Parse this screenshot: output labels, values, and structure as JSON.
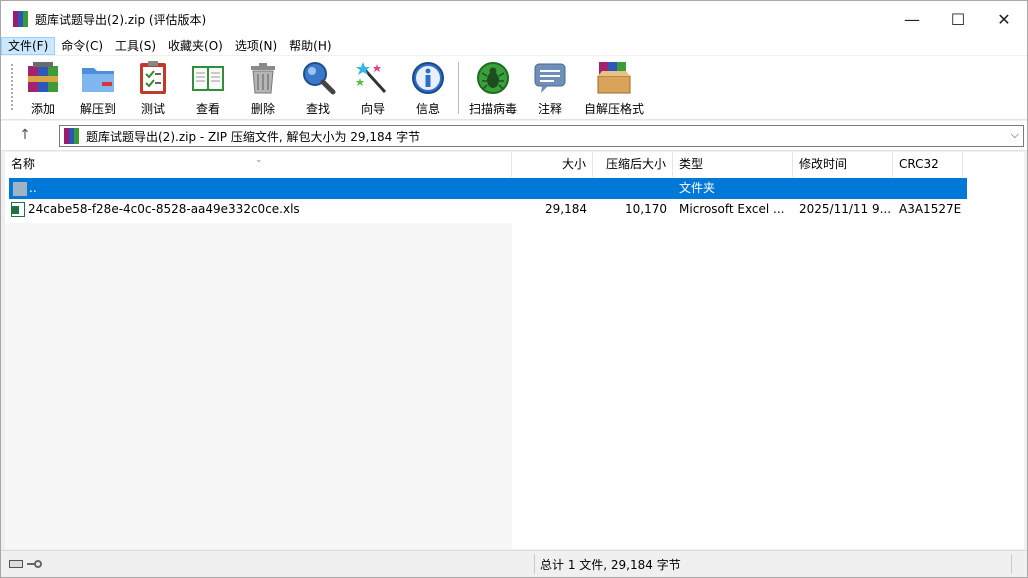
{
  "window": {
    "title": "题库试题导出(2).zip (评估版本)",
    "controls": {
      "minimize": "—",
      "maximize": "☐",
      "close": "✕"
    }
  },
  "menu": [
    {
      "label": "文件(F)",
      "active": true
    },
    {
      "label": "命令(C)"
    },
    {
      "label": "工具(S)"
    },
    {
      "label": "收藏夹(O)"
    },
    {
      "label": "选项(N)"
    },
    {
      "label": "帮助(H)"
    }
  ],
  "toolbar": {
    "add": "添加",
    "extract": "解压到",
    "test": "测试",
    "view": "查看",
    "delete": "删除",
    "find": "查找",
    "wizard": "向导",
    "info": "信息",
    "virus_scan": "扫描病毒",
    "comment": "注释",
    "sfx": "自解压格式"
  },
  "address": {
    "up": "↑",
    "text": "题库试题导出(2).zip - ZIP 压缩文件, 解包大小为 29,184 字节",
    "dropdown": "⌵"
  },
  "columns": {
    "name": "名称",
    "size": "大小",
    "packed": "压缩后大小",
    "type": "类型",
    "modified": "修改时间",
    "crc": "CRC32"
  },
  "rows": [
    {
      "name": "..",
      "size": "",
      "packed": "",
      "type": "文件夹",
      "modified": "",
      "crc": ""
    },
    {
      "name": "24cabe58-f28e-4c0c-8528-aa49e332c0ce.xls",
      "size": "29,184",
      "packed": "10,170",
      "type": "Microsoft Excel ...",
      "modified": "2025/11/11 9...",
      "crc": "A3A1527E"
    }
  ],
  "status": {
    "summary": "总计 1 文件, 29,184 字节"
  },
  "colors": {
    "selection": "#0078d7",
    "menu_active": "#cce8ff"
  }
}
